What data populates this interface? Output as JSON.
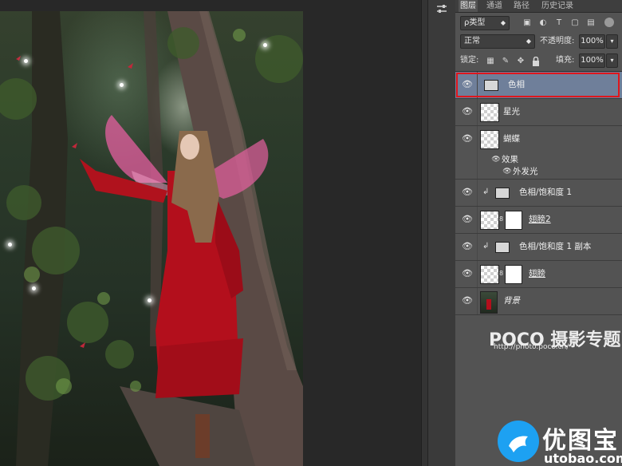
{
  "panel_tabs": [
    "图层",
    "通道",
    "路径",
    "历史记录"
  ],
  "filter": {
    "label": "ρ类型"
  },
  "blend": {
    "mode": "正常",
    "opacity_label": "不透明度:",
    "opacity_value": "100%"
  },
  "lock": {
    "label": "锁定:",
    "fill_label": "填充:",
    "fill_value": "100%"
  },
  "layers": [
    {
      "name": "色相",
      "kind": "adjustment",
      "selected": true
    },
    {
      "name": "星光",
      "kind": "pixel"
    },
    {
      "name": "蝴蝶",
      "kind": "pixel"
    },
    {
      "name": "效果",
      "kind": "effects"
    },
    {
      "name": "外发光",
      "kind": "effect"
    },
    {
      "name": "色相/饱和度 1",
      "kind": "adjustment",
      "clipped": true
    },
    {
      "name": "翅膀2",
      "kind": "masked"
    },
    {
      "name": "色相/饱和度 1 副本",
      "kind": "adjustment",
      "clipped": true
    },
    {
      "name": "翅膀",
      "kind": "masked"
    },
    {
      "name": "背景",
      "kind": "background"
    }
  ],
  "watermark": {
    "logo": "POCO 摄影专题",
    "url": "http://photo.poco.cn/"
  },
  "brand": {
    "name": "优图宝",
    "url": "utobao.com"
  },
  "colors": {
    "selection": "#6f7f9a",
    "highlight": "#e0161c",
    "panel": "#535353",
    "brand": "#1da1f2"
  },
  "icons": [
    "eye-icon",
    "filter-icon",
    "lock-icon",
    "link-icon",
    "dress-photo"
  ]
}
